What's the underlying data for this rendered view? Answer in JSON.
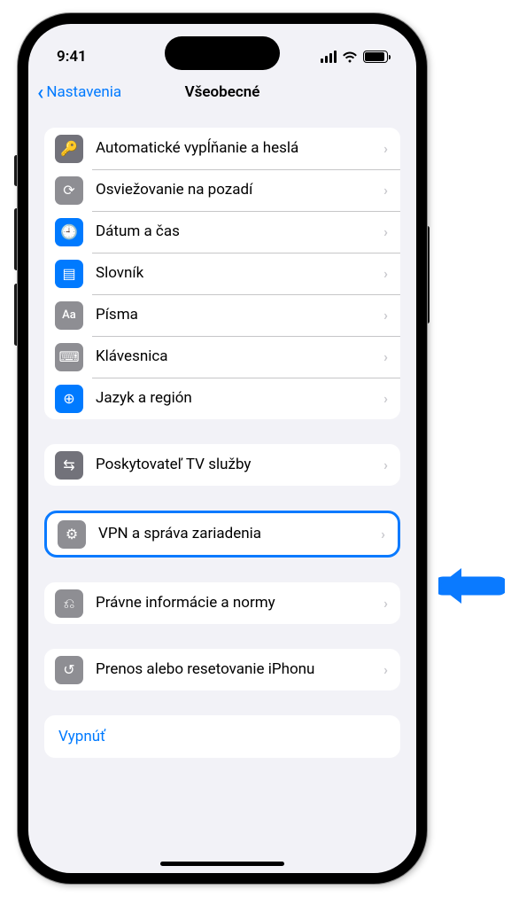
{
  "status": {
    "time": "9:41"
  },
  "nav": {
    "back_label": "Nastavenia",
    "title": "Všeobecné"
  },
  "groups": [
    {
      "rows": [
        {
          "icon": "key-icon",
          "icon_class": "ic-gray-dark",
          "glyph": "🔑",
          "label": "Automatické vypĺňanie a heslá"
        },
        {
          "icon": "refresh-bg-icon",
          "icon_class": "ic-gray",
          "glyph": "⟳",
          "label": "Osviežovanie na pozadí"
        },
        {
          "icon": "calendar-clock-icon",
          "icon_class": "ic-blue",
          "glyph": "🕘",
          "label": "Dátum a čas"
        },
        {
          "icon": "book-icon",
          "icon_class": "ic-blue",
          "glyph": "▤",
          "label": "Slovník"
        },
        {
          "icon": "fonts-icon",
          "icon_class": "ic-gray",
          "glyph": "Aa",
          "label": "Písma"
        },
        {
          "icon": "keyboard-icon",
          "icon_class": "ic-gray",
          "glyph": "⌨",
          "label": "Klávesnica"
        },
        {
          "icon": "globe-icon",
          "icon_class": "ic-blue",
          "glyph": "⊕",
          "label": "Jazyk a región"
        }
      ]
    },
    {
      "rows": [
        {
          "icon": "tv-provider-icon",
          "icon_class": "ic-gray-dark",
          "glyph": "⇆",
          "label": "Poskytovateľ TV služby"
        }
      ]
    },
    {
      "highlighted": true,
      "rows": [
        {
          "icon": "gear-icon",
          "icon_class": "ic-gray",
          "glyph": "⚙",
          "label": "VPN a správa zariadenia"
        }
      ]
    },
    {
      "rows": [
        {
          "icon": "legal-icon",
          "icon_class": "ic-gray",
          "glyph": "⎌",
          "label": "Právne informácie a normy"
        }
      ]
    },
    {
      "rows": [
        {
          "icon": "reset-icon",
          "icon_class": "ic-gray",
          "glyph": "↺",
          "label": "Prenos alebo resetovanie iPhonu"
        }
      ]
    }
  ],
  "shutdown": {
    "label": "Vypnúť"
  }
}
